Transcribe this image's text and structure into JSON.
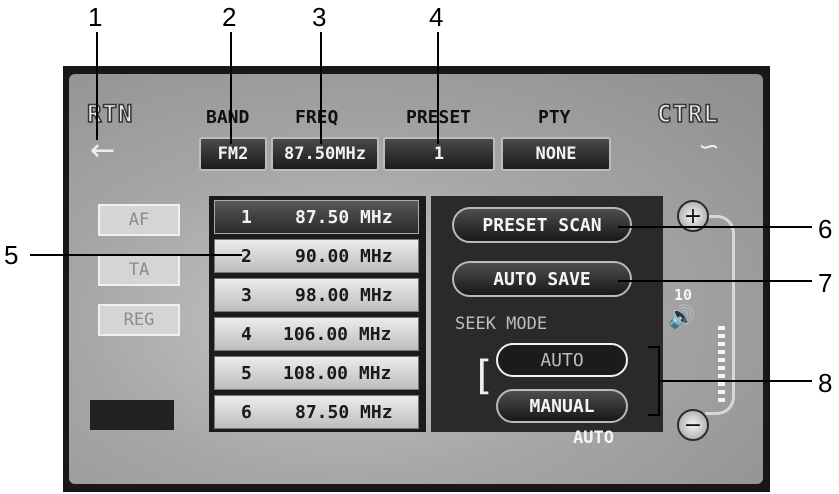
{
  "callouts": [
    "1",
    "2",
    "3",
    "4",
    "5",
    "6",
    "7",
    "8"
  ],
  "header": {
    "rtn_logo": "RTN",
    "ctrl_logo": "CTRL",
    "band_label": "BAND",
    "freq_label": "FREQ",
    "preset_label": "PRESET",
    "pty_label": "PTY",
    "band_value": "FM2",
    "freq_value": "87.50MHz",
    "preset_value": "1",
    "pty_value": "NONE"
  },
  "side_buttons": {
    "af": "AF",
    "ta": "TA",
    "reg": "REG"
  },
  "presets": [
    {
      "num": "1",
      "freq": "87.50 MHz"
    },
    {
      "num": "2",
      "freq": "90.00 MHz"
    },
    {
      "num": "3",
      "freq": "98.00 MHz"
    },
    {
      "num": "4",
      "freq": "106.00 MHz"
    },
    {
      "num": "5",
      "freq": "108.00 MHz"
    },
    {
      "num": "6",
      "freq": "87.50 MHz"
    }
  ],
  "controls": {
    "preset_scan": "PRESET SCAN",
    "auto_save": "AUTO SAVE",
    "seek_mode_label": "SEEK MODE",
    "seek_auto": "AUTO",
    "seek_manual": "MANUAL"
  },
  "volume": {
    "level": "10",
    "plus": "+",
    "minus": "−"
  },
  "status": {
    "mode": "AUTO"
  },
  "icons": {
    "back": "back-arrow-icon",
    "settings": "wrench-icon",
    "speaker": "speaker-icon"
  }
}
